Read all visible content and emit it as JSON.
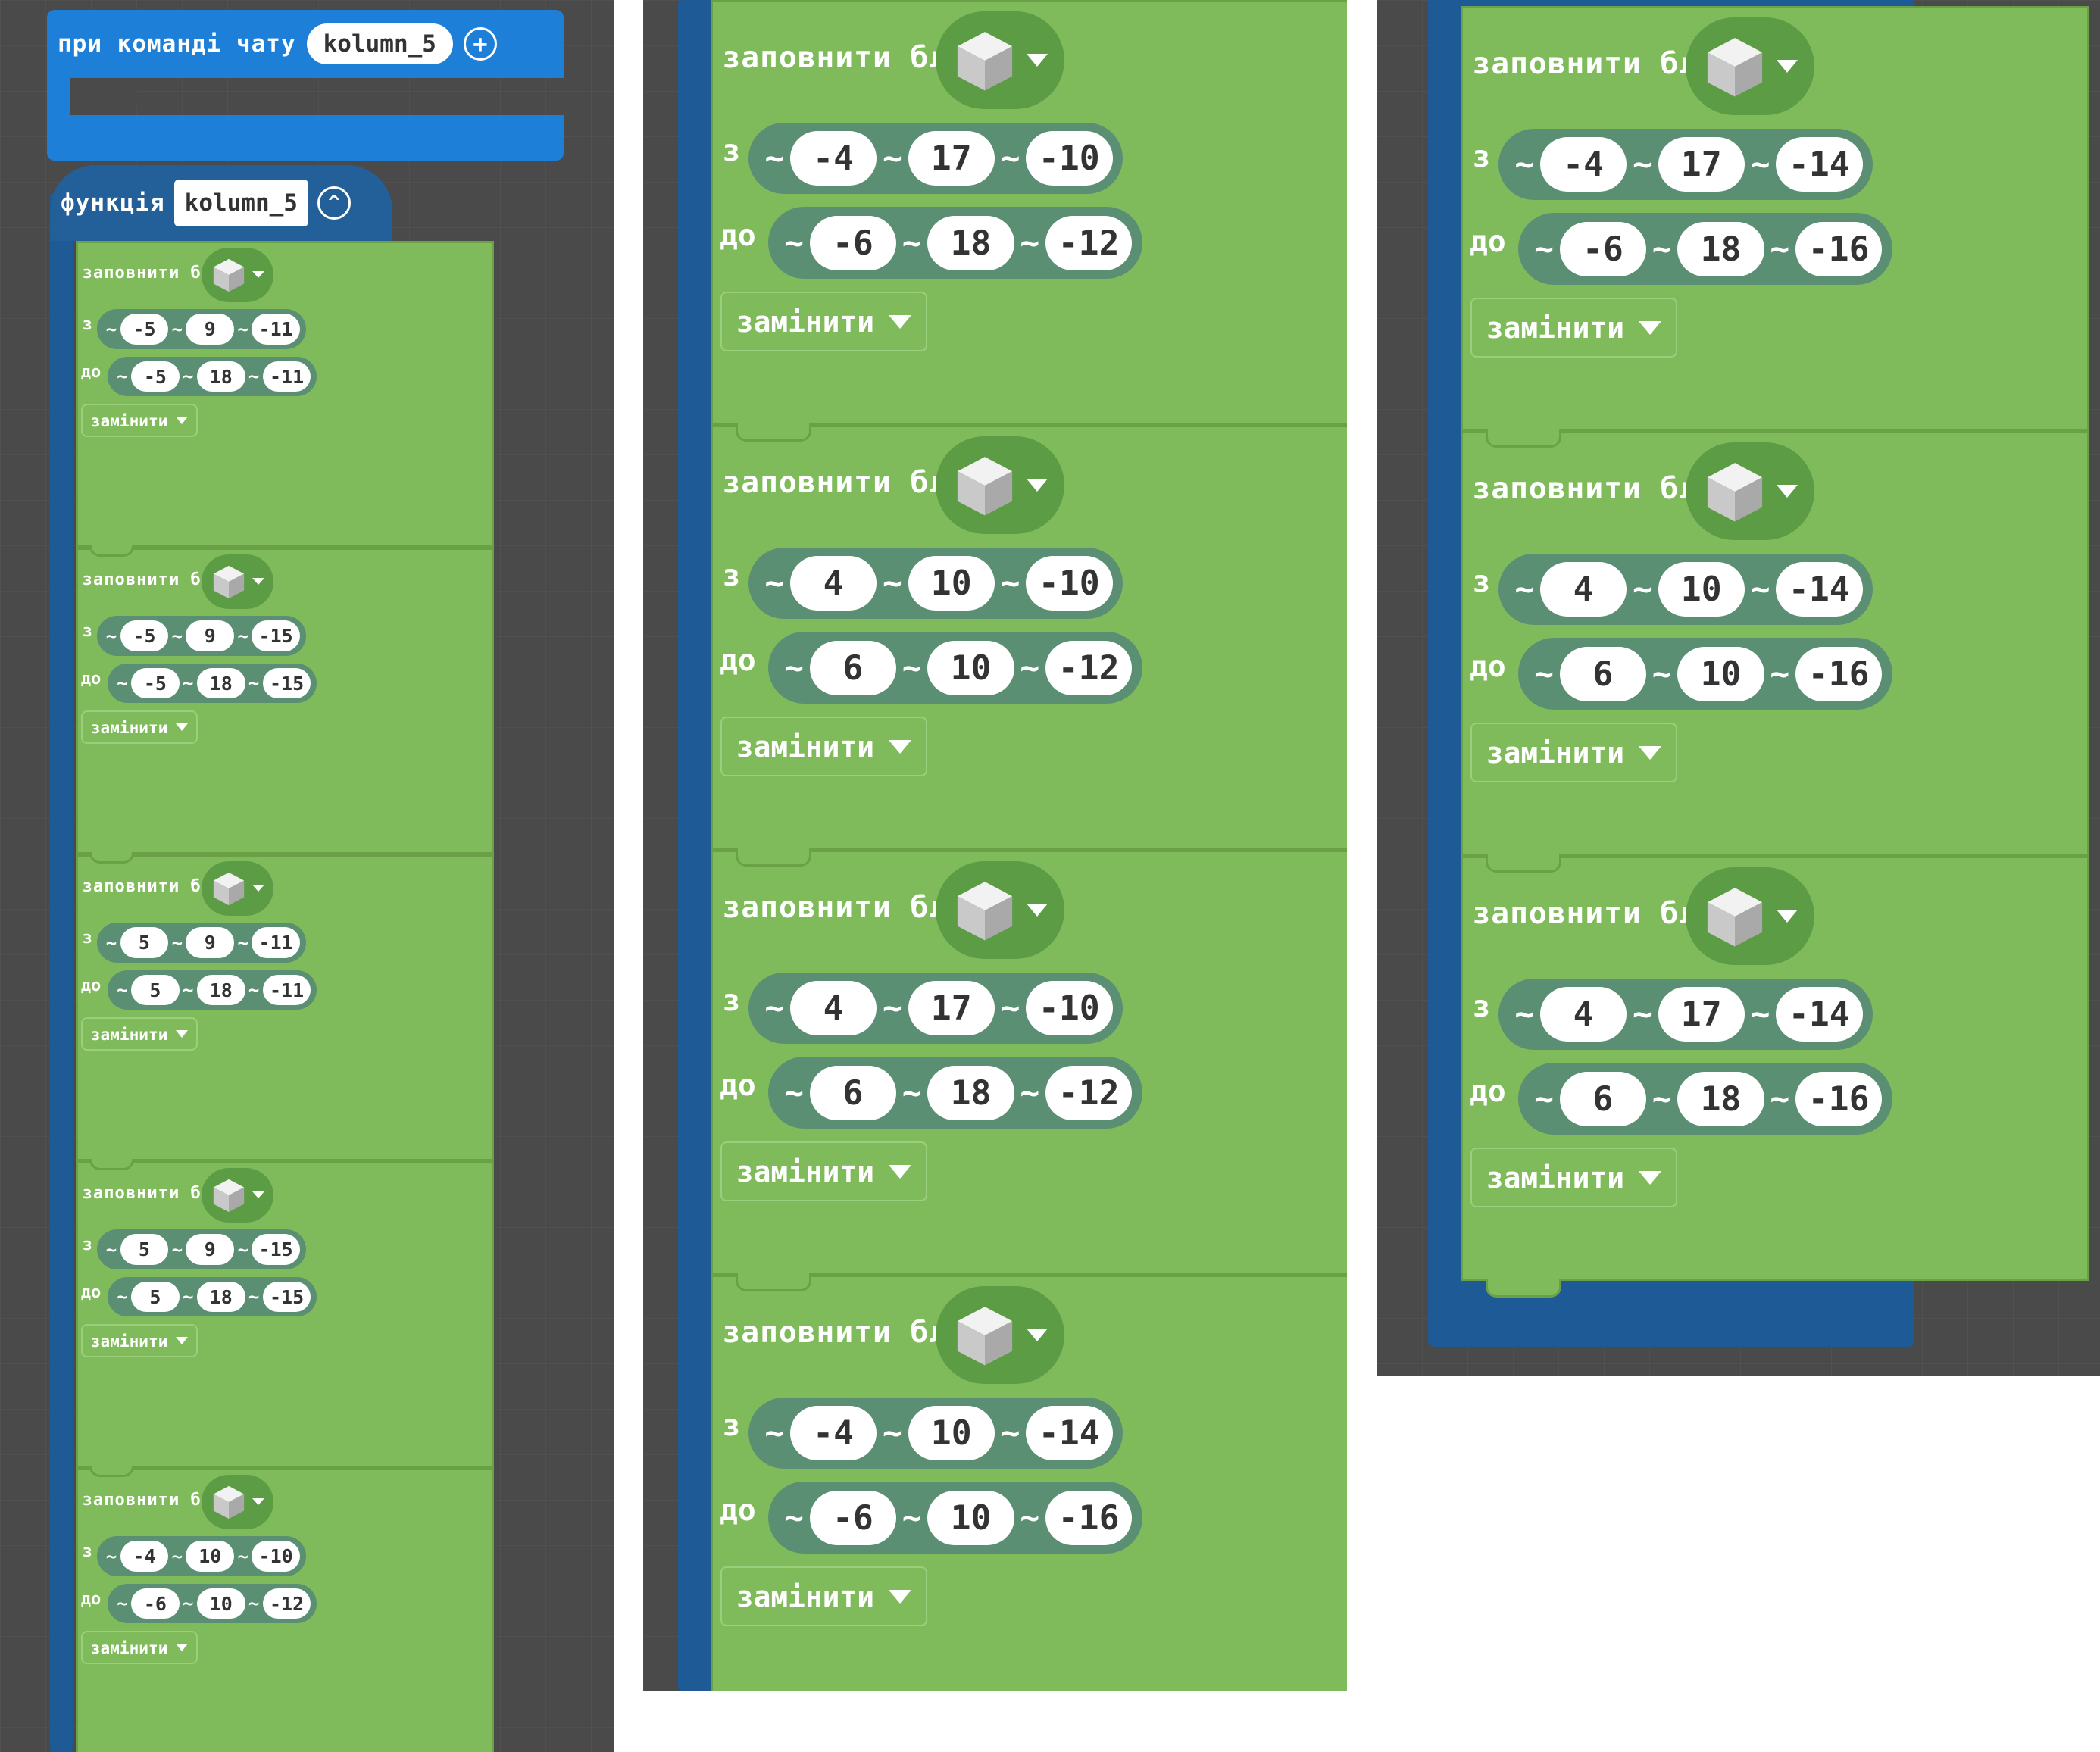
{
  "event_block": {
    "label": "при команді чату",
    "name": "kolumn_5"
  },
  "function_block": {
    "label": "функція",
    "name": "kolumn_5"
  },
  "fill_title": "заповнити блоками",
  "from_label": "з",
  "to_label": "до",
  "mode_label": "замінити",
  "tilde": "~",
  "panels": [
    {
      "blocks": [
        {
          "from": [
            "-5",
            "9",
            "-11"
          ],
          "to": [
            "-5",
            "18",
            "-11"
          ]
        },
        {
          "from": [
            "-5",
            "9",
            "-15"
          ],
          "to": [
            "-5",
            "18",
            "-15"
          ]
        },
        {
          "from": [
            "5",
            "9",
            "-11"
          ],
          "to": [
            "5",
            "18",
            "-11"
          ]
        },
        {
          "from": [
            "5",
            "9",
            "-15"
          ],
          "to": [
            "5",
            "18",
            "-15"
          ]
        },
        {
          "from": [
            "-4",
            "10",
            "-10"
          ],
          "to": [
            "-6",
            "10",
            "-12"
          ]
        }
      ]
    },
    {
      "blocks": [
        {
          "from": [
            "-4",
            "17",
            "-10"
          ],
          "to": [
            "-6",
            "18",
            "-12"
          ]
        },
        {
          "from": [
            "4",
            "10",
            "-10"
          ],
          "to": [
            "6",
            "10",
            "-12"
          ]
        },
        {
          "from": [
            "4",
            "17",
            "-10"
          ],
          "to": [
            "6",
            "18",
            "-12"
          ]
        },
        {
          "from": [
            "-4",
            "10",
            "-14"
          ],
          "to": [
            "-6",
            "10",
            "-16"
          ]
        }
      ]
    },
    {
      "blocks": [
        {
          "from": [
            "-4",
            "17",
            "-14"
          ],
          "to": [
            "-6",
            "18",
            "-16"
          ]
        },
        {
          "from": [
            "4",
            "10",
            "-14"
          ],
          "to": [
            "6",
            "10",
            "-16"
          ]
        },
        {
          "from": [
            "4",
            "17",
            "-14"
          ],
          "to": [
            "6",
            "18",
            "-16"
          ]
        }
      ]
    }
  ],
  "colors": {
    "panel_bg": "#4a4a4a",
    "event_blue": "#1e7fd8",
    "function_blue": "#235f98",
    "block_green": "#7fbb5b",
    "pill_teal": "#5b8f73"
  },
  "icons": [
    "add-circle-icon",
    "collapse-icon",
    "cube-icon",
    "caret-down-icon"
  ]
}
